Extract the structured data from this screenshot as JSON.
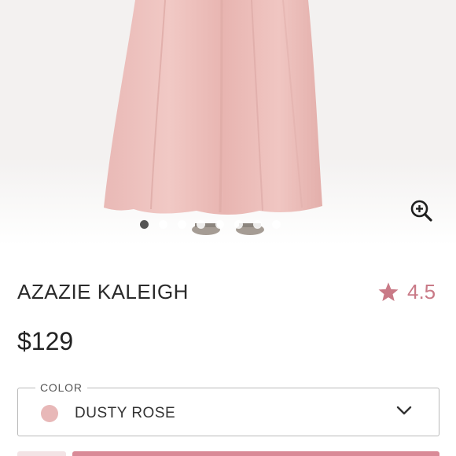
{
  "gallery": {
    "image_icon": "dress-photo",
    "dots_count": 8,
    "active_dot": 0,
    "zoom_icon": "zoom-in-icon"
  },
  "product": {
    "title": "AZAZIE KALEIGH",
    "rating": "4.5",
    "rating_icon": "star-icon",
    "price": "$129"
  },
  "color_select": {
    "label": "COLOR",
    "value": "DUSTY ROSE",
    "swatch_color": "#e8b8b8",
    "chevron_icon": "chevron-down-icon"
  },
  "colors": {
    "accent": "#c97a87",
    "button": "#d98a97"
  }
}
